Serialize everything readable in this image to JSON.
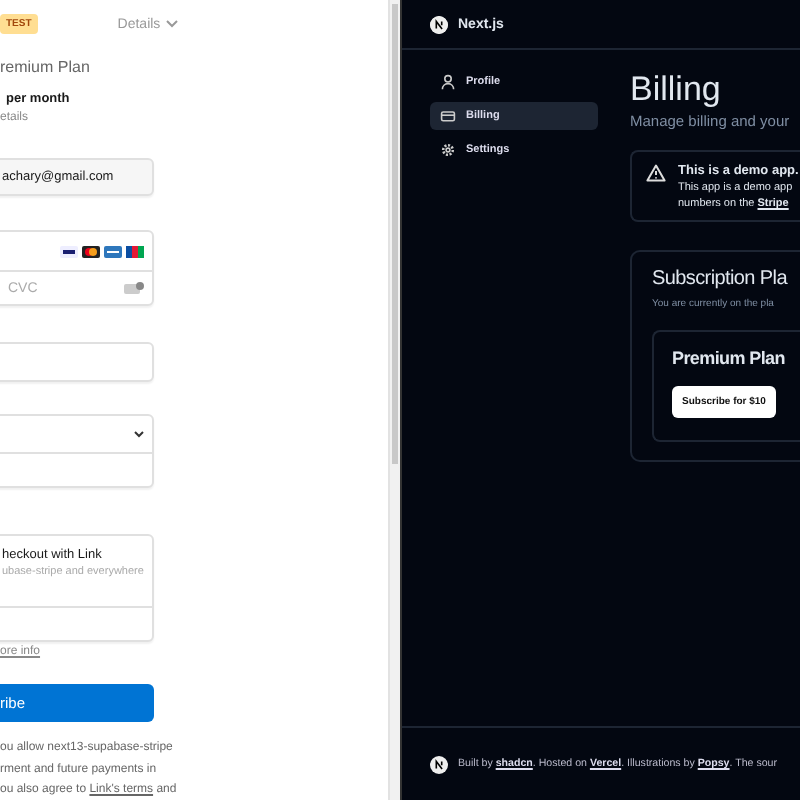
{
  "checkout": {
    "badge": "TEST",
    "details": "Details",
    "product": "remium Plan",
    "price_period": "per month",
    "details_link": "etails",
    "email": "achary@gmail.com",
    "cvc_placeholder": "CVC",
    "link_box": {
      "title": "heckout with Link",
      "subtitle": "ubase-stripe and everywhere"
    },
    "more_info": "ore info",
    "subscribe": "ribe",
    "terms": [
      {
        "text": "ou allow next13-supabase-stripe"
      },
      {
        "text": "rment and future payments in"
      },
      {
        "text": "ou also agree to ",
        "link": "Link's terms",
        "after": " and"
      }
    ]
  },
  "app": {
    "brand": "Next.js",
    "nav": [
      {
        "label": "Profile",
        "selected": false
      },
      {
        "label": "Billing",
        "selected": true
      },
      {
        "label": "Settings",
        "selected": false
      }
    ],
    "title": "Billing",
    "subtitle": "Manage billing and your",
    "alert": {
      "title": "This is a demo app.",
      "line_1": "This app is a demo app",
      "line_2": "numbers on the",
      "link": "Stripe"
    },
    "plan_card": {
      "title": "Subscription Pla",
      "subtitle": "You are currently on the pla",
      "plan": "Premium Plan",
      "button": "Subscribe for $10"
    },
    "footer": [
      {
        "kind": "text",
        "text": "Built by "
      },
      {
        "kind": "link",
        "text": "shadcn"
      },
      {
        "kind": "text",
        "text": ". Hosted on "
      },
      {
        "kind": "link",
        "text": "Vercel"
      },
      {
        "kind": "text",
        "text": ". Illustrations by "
      },
      {
        "kind": "link",
        "text": "Popsy"
      },
      {
        "kind": "text",
        "text": ". The sour"
      }
    ]
  }
}
